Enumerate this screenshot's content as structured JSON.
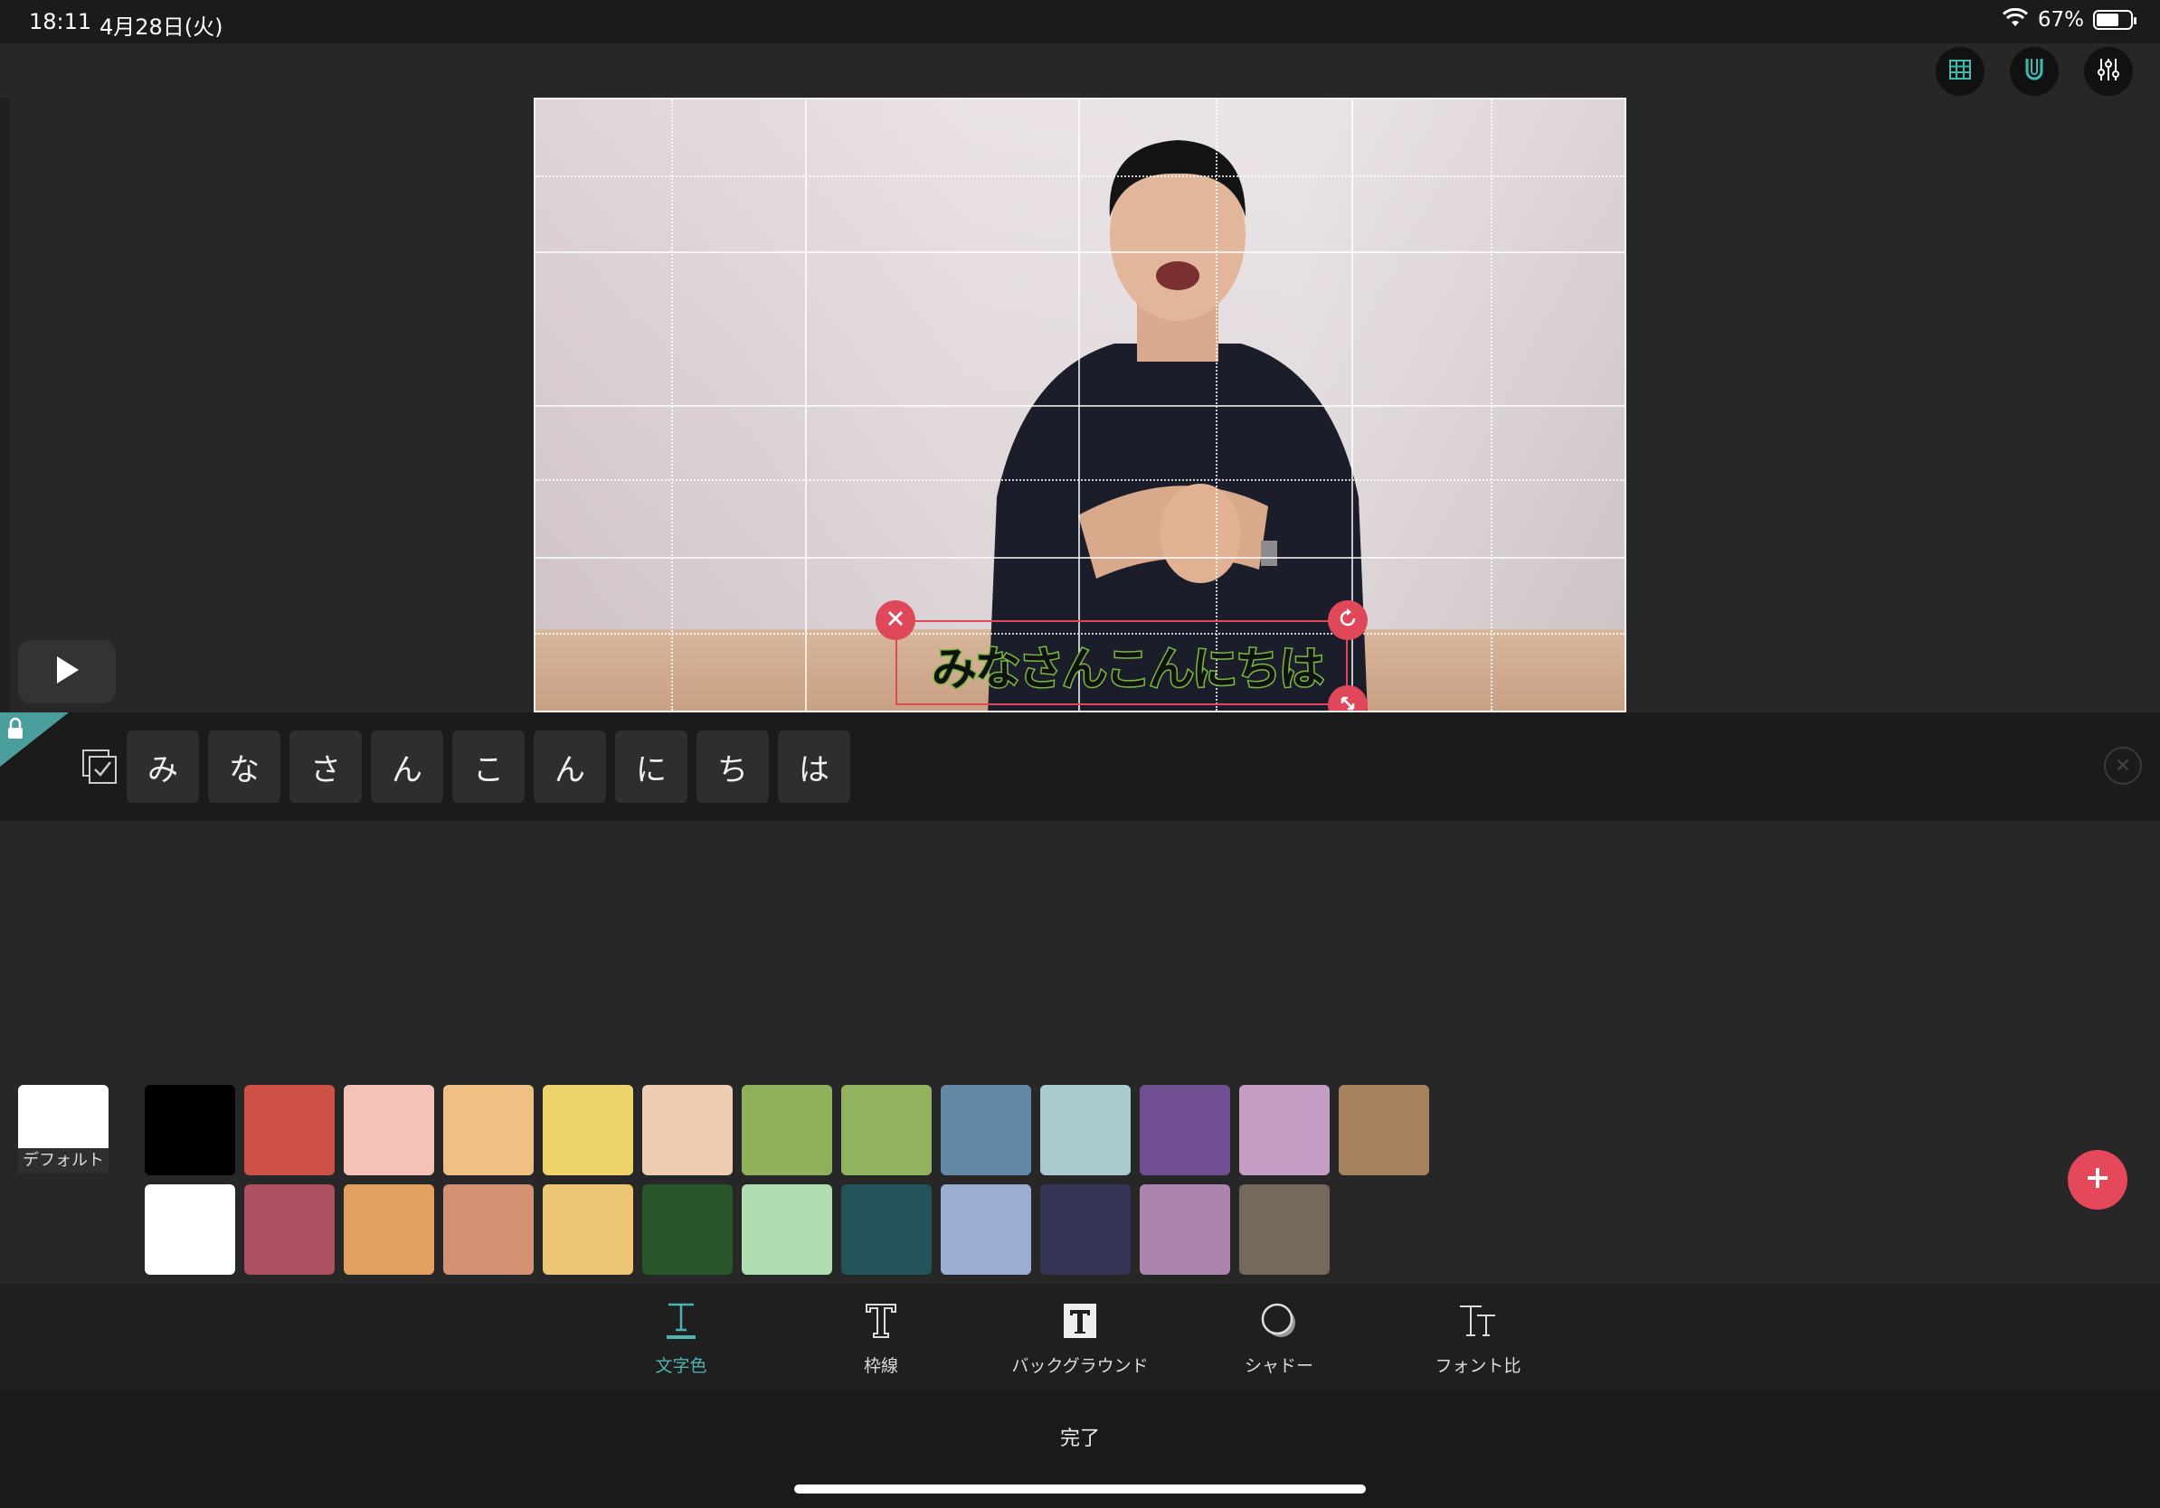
{
  "status_bar": {
    "time": "18:11",
    "date": "4月28日(火)",
    "battery_percent": "67%",
    "battery_level": 0.67
  },
  "top_tools": [
    {
      "name": "grid-icon"
    },
    {
      "name": "magnet-icon"
    },
    {
      "name": "sliders-icon"
    }
  ],
  "preview": {
    "subtitle_text": "みなさんこんにちは"
  },
  "characters": [
    "み",
    "な",
    "さ",
    "ん",
    "こ",
    "ん",
    "に",
    "ち",
    "は"
  ],
  "color_panel": {
    "default_label": "デフォルト",
    "default_color": "#ffffff",
    "row1": [
      "#000000",
      "#cf5046",
      "#f4c2b6",
      "#efbf84",
      "#eed36c",
      "#efcdb0",
      "#8fb15b",
      "#91b25f",
      "#628aa8",
      "#a9cbcf",
      "#6f4e91",
      "#c39dc3",
      "#a6825f"
    ],
    "row2": [
      "#ffffff",
      "#ae5062",
      "#e1a05f",
      "#d39274",
      "#edc575",
      "#26562a",
      "#b0ddb2",
      "#245459",
      "#9aadd2",
      "#353557",
      "#ab85ad",
      "#76685a"
    ]
  },
  "tabs": [
    {
      "label": "文字色",
      "icon": "text-color-icon",
      "active": true
    },
    {
      "label": "枠線",
      "icon": "text-outline-icon",
      "active": false
    },
    {
      "label": "バックグラウンド",
      "icon": "text-background-icon",
      "active": false
    },
    {
      "label": "シャドー",
      "icon": "shadow-icon",
      "active": false
    },
    {
      "label": "フォント比",
      "icon": "font-ratio-icon",
      "active": false
    }
  ],
  "footer": {
    "done_label": "完了"
  },
  "accent_color": "#4fb3b0",
  "danger_color": "#e5485a"
}
